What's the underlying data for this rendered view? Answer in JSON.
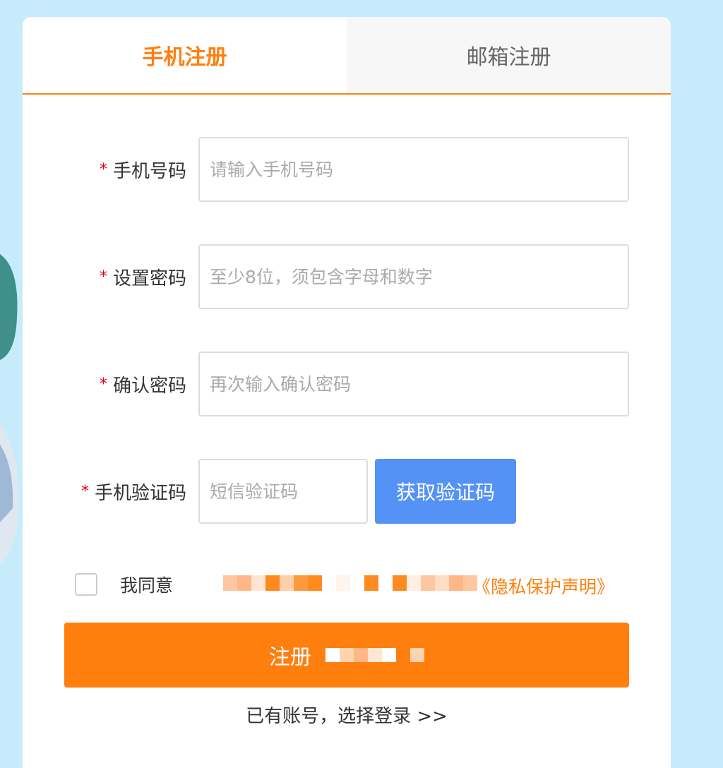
{
  "tabs": {
    "phone": "手机注册",
    "email": "邮箱注册"
  },
  "form": {
    "phone": {
      "label": "手机号码",
      "placeholder": "请输入手机号码"
    },
    "password": {
      "label": "设置密码",
      "placeholder": "至少8位，须包含字母和数字"
    },
    "confirm": {
      "label": "确认密码",
      "placeholder": "再次输入确认密码"
    },
    "sms": {
      "label": "手机验证码",
      "placeholder": "短信验证码",
      "button": "获取验证码"
    },
    "required_mark": "*"
  },
  "agreement": {
    "prefix": "我同意",
    "privacy_link": "《隐私保护声明》"
  },
  "register_button": "注册",
  "login_link": "已有账号，选择登录 >>",
  "colors": {
    "accent": "#ff7f0e",
    "code_button": "#5592f5",
    "background": "#c6ecfb"
  }
}
